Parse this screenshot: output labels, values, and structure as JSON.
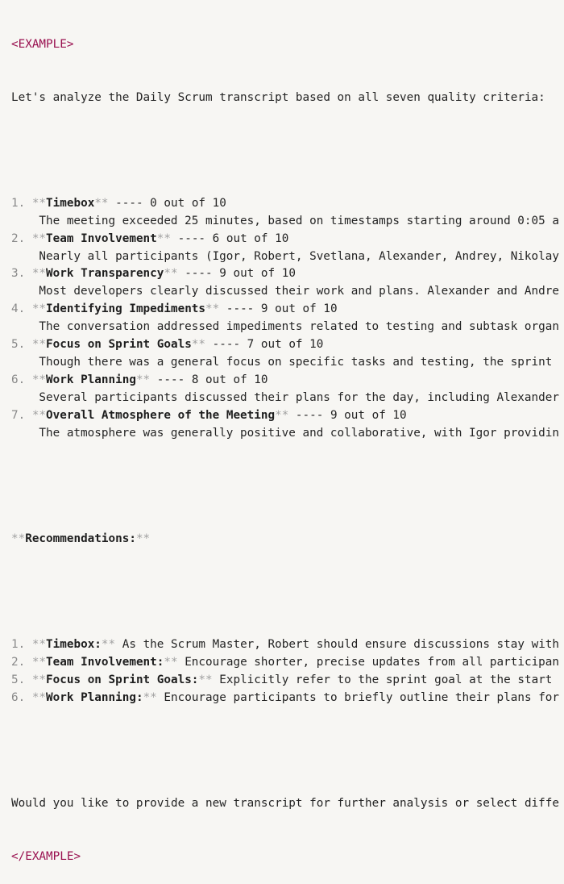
{
  "open_tag": "<EXAMPLE>",
  "close_tag": "</EXAMPLE>",
  "intro": "Let's analyze the Daily Scrum transcript based on all seven quality criteria:",
  "criteria": [
    {
      "num": "1.",
      "title": "Timebox",
      "score": "---- 0 out of 10",
      "desc": "The meeting exceeded 25 minutes, based on timestamps starting around 0:05 a"
    },
    {
      "num": "2.",
      "title": "Team Involvement",
      "score": "---- 6 out of 10",
      "desc": "Nearly all participants (Igor, Robert, Svetlana, Alexander, Andrey, Nikolay"
    },
    {
      "num": "3.",
      "title": "Work Transparency",
      "score": "---- 9 out of 10",
      "desc": "Most developers clearly discussed their work and plans. Alexander and Andre"
    },
    {
      "num": "4.",
      "title": "Identifying Impediments",
      "score": "---- 9 out of 10",
      "desc": "The conversation addressed impediments related to testing and subtask organ"
    },
    {
      "num": "5.",
      "title": "Focus on Sprint Goals",
      "score": "---- 7 out of 10",
      "desc": "Though there was a general focus on specific tasks and testing, the sprint "
    },
    {
      "num": "6.",
      "title": "Work Planning",
      "score": "---- 8 out of 10",
      "desc": "Several participants discussed their plans for the day, including Alexander"
    },
    {
      "num": "7.",
      "title": "Overall Atmosphere of the Meeting",
      "score": "---- 9 out of 10",
      "desc": "The atmosphere was generally positive and collaborative, with Igor providin"
    }
  ],
  "recommendations_heading": "Recommendations:",
  "recommendations": [
    {
      "num": "1.",
      "title": "Timebox:",
      "text": "As the Scrum Master, Robert should ensure discussions stay with"
    },
    {
      "num": "2.",
      "title": "Team Involvement:",
      "text": "Encourage shorter, precise updates from all participan"
    },
    {
      "num": "5.",
      "title": "Focus on Sprint Goals:",
      "text": "Explicitly refer to the sprint goal at the start"
    },
    {
      "num": "6.",
      "title": "Work Planning:",
      "text": "Encourage participants to briefly outline their plans for"
    }
  ],
  "closing": "Would you like to provide a new transcript for further analysis or select diffe",
  "markers": {
    "bold": "**"
  }
}
